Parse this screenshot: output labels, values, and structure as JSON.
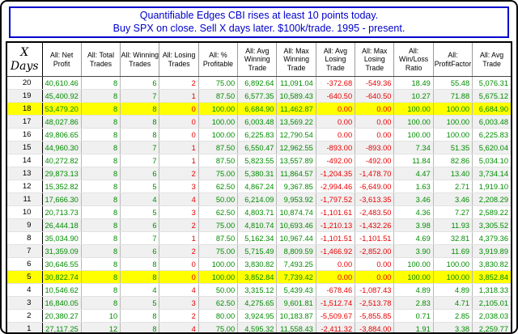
{
  "title": {
    "line1": "Quantifiable Edges CBI rises at least 10 points today.",
    "line2": "Buy SPX on close. Sell X days later. $100k/trade. 1995 - present."
  },
  "chart_data": {
    "type": "table",
    "title": "Quantifiable Edges CBI rises at least 10 points today. Buy SPX on close. Sell X days later. $100k/trade. 1995 - present.",
    "row_header": "X Days",
    "columns": [
      "All: Net Profit",
      "All: Total Trades",
      "All: Winning Trades",
      "All: Losing Trades",
      "All: % Profitable",
      "All: Avg Winning Trade",
      "All: Max Winning Trade",
      "All: Avg Losing Trade",
      "All: Max Losing Trade",
      "All: Win/Loss Ratio",
      "All: ProfitFactor",
      "All: Avg Trade"
    ],
    "rows": [
      {
        "x_days": "20",
        "highlight": false,
        "cells": [
          "40,610.46",
          "8",
          "6",
          "2",
          "75.00",
          "6,892.64",
          "11,091.04",
          "-372.68",
          "-549.36",
          "18.49",
          "55.48",
          "5,076.31"
        ]
      },
      {
        "x_days": "19",
        "highlight": false,
        "cells": [
          "45,400.92",
          "8",
          "7",
          "1",
          "87.50",
          "6,577.35",
          "10,589.43",
          "-640.50",
          "-640.50",
          "10.27",
          "71.88",
          "5,675.12"
        ]
      },
      {
        "x_days": "18",
        "highlight": true,
        "cells": [
          "53,479.20",
          "8",
          "8",
          "0",
          "100.00",
          "6,684.90",
          "11,462.87",
          "0.00",
          "0.00",
          "100.00",
          "100.00",
          "6,684.90"
        ]
      },
      {
        "x_days": "17",
        "highlight": false,
        "cells": [
          "48,027.86",
          "8",
          "8",
          "0",
          "100.00",
          "6,003.48",
          "13,569.22",
          "0.00",
          "0.00",
          "100.00",
          "100.00",
          "6,003.48"
        ]
      },
      {
        "x_days": "16",
        "highlight": false,
        "cells": [
          "49,806.65",
          "8",
          "8",
          "0",
          "100.00",
          "6,225.83",
          "12,790.54",
          "0.00",
          "0.00",
          "100.00",
          "100.00",
          "6,225.83"
        ]
      },
      {
        "x_days": "15",
        "highlight": false,
        "cells": [
          "44,960.30",
          "8",
          "7",
          "1",
          "87.50",
          "6,550.47",
          "12,962.55",
          "-893.00",
          "-893.00",
          "7.34",
          "51.35",
          "5,620.04"
        ]
      },
      {
        "x_days": "14",
        "highlight": false,
        "cells": [
          "40,272.82",
          "8",
          "7",
          "1",
          "87.50",
          "5,823.55",
          "13,557.89",
          "-492.00",
          "-492.00",
          "11.84",
          "82.86",
          "5,034.10"
        ]
      },
      {
        "x_days": "13",
        "highlight": false,
        "cells": [
          "29,873.13",
          "8",
          "6",
          "2",
          "75.00",
          "5,380.31",
          "11,864.57",
          "-1,204.35",
          "-1,478.70",
          "4.47",
          "13.40",
          "3,734.14"
        ]
      },
      {
        "x_days": "12",
        "highlight": false,
        "cells": [
          "15,352.82",
          "8",
          "5",
          "3",
          "62.50",
          "4,867.24",
          "9,367.85",
          "-2,994.46",
          "-6,649.00",
          "1.63",
          "2.71",
          "1,919.10"
        ]
      },
      {
        "x_days": "11",
        "highlight": false,
        "cells": [
          "17,666.30",
          "8",
          "4",
          "4",
          "50.00",
          "6,214.09",
          "9,953.92",
          "-1,797.52",
          "-3,613.35",
          "3.46",
          "3.46",
          "2,208.29"
        ]
      },
      {
        "x_days": "10",
        "highlight": false,
        "cells": [
          "20,713.73",
          "8",
          "5",
          "3",
          "62.50",
          "4,803.71",
          "10,874.74",
          "-1,101.61",
          "-2,483.50",
          "4.36",
          "7.27",
          "2,589.22"
        ]
      },
      {
        "x_days": "9",
        "highlight": false,
        "cells": [
          "26,444.18",
          "8",
          "6",
          "2",
          "75.00",
          "4,810.74",
          "10,693.46",
          "-1,210.13",
          "-1,432.26",
          "3.98",
          "11.93",
          "3,305.52"
        ]
      },
      {
        "x_days": "8",
        "highlight": false,
        "cells": [
          "35,034.90",
          "8",
          "7",
          "1",
          "87.50",
          "5,162.34",
          "10,967.44",
          "-1,101.51",
          "-1,101.51",
          "4.69",
          "32.81",
          "4,379.36"
        ]
      },
      {
        "x_days": "7",
        "highlight": false,
        "cells": [
          "31,359.09",
          "8",
          "6",
          "2",
          "75.00",
          "5,715.49",
          "8,809.59",
          "-1,466.92",
          "-2,852.00",
          "3.90",
          "11.69",
          "3,919.89"
        ]
      },
      {
        "x_days": "6",
        "highlight": false,
        "cells": [
          "30,646.55",
          "8",
          "8",
          "0",
          "100.00",
          "3,830.82",
          "7,493.25",
          "0.00",
          "0.00",
          "100.00",
          "100.00",
          "3,830.82"
        ]
      },
      {
        "x_days": "5",
        "highlight": true,
        "cells": [
          "30,822.74",
          "8",
          "8",
          "0",
          "100.00",
          "3,852.84",
          "7,739.42",
          "0.00",
          "0.00",
          "100.00",
          "100.00",
          "3,852.84"
        ]
      },
      {
        "x_days": "4",
        "highlight": false,
        "cells": [
          "10,546.62",
          "8",
          "4",
          "4",
          "50.00",
          "3,315.12",
          "5,439.43",
          "-678.46",
          "-1,087.43",
          "4.89",
          "4.89",
          "1,318.33"
        ]
      },
      {
        "x_days": "3",
        "highlight": false,
        "cells": [
          "16,840.05",
          "8",
          "5",
          "3",
          "62.50",
          "4,275.65",
          "9,601.81",
          "-1,512.74",
          "-2,513.78",
          "2.83",
          "4.71",
          "2,105.01"
        ]
      },
      {
        "x_days": "2",
        "highlight": false,
        "cells": [
          "20,380.27",
          "10",
          "8",
          "2",
          "80.00",
          "3,924.95",
          "10,183.87",
          "-5,509.67",
          "-5,855.85",
          "0.71",
          "2.85",
          "2,038.03"
        ]
      },
      {
        "x_days": "1",
        "highlight": false,
        "cells": [
          "27,117.25",
          "12",
          "8",
          "4",
          "75.00",
          "4,595.32",
          "11,558.43",
          "-2,411.32",
          "-3,884.00",
          "1.91",
          "3.38",
          "2,259.77"
        ]
      }
    ]
  },
  "style": {
    "title_color": "#0000cc",
    "positive_color": "#008c00",
    "negative_color": "#e80000",
    "highlight_color": "#ffff00",
    "red_column_indices": [
      3,
      7,
      8
    ]
  }
}
